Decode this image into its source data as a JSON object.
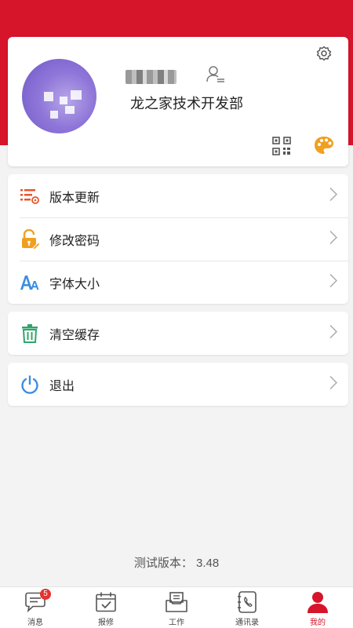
{
  "profile": {
    "department": "龙之家技术开发部",
    "avatar_icon": "blurred-avatar",
    "settings_icon": "gear-icon",
    "edit_profile_icon": "user-edit-icon",
    "qr_icon": "qr-code-icon",
    "theme_icon": "palette-icon"
  },
  "menu": {
    "group1": [
      {
        "label": "版本更新",
        "icon": "list-settings-icon"
      },
      {
        "label": "修改密码",
        "icon": "lock-edit-icon"
      },
      {
        "label": "字体大小",
        "icon": "font-size-icon"
      }
    ],
    "group2": [
      {
        "label": "清空缓存",
        "icon": "trash-icon"
      }
    ],
    "group3": [
      {
        "label": "退出",
        "icon": "power-icon"
      }
    ]
  },
  "version_text": "测试版本： 3.48",
  "tabbar": {
    "tabs": [
      {
        "label": "消息",
        "icon": "message-icon",
        "badge": "5"
      },
      {
        "label": "报修",
        "icon": "calendar-check-icon"
      },
      {
        "label": "工作",
        "icon": "inbox-icon"
      },
      {
        "label": "通讯录",
        "icon": "contacts-book-icon"
      },
      {
        "label": "我的",
        "icon": "user-icon",
        "active": true
      }
    ]
  },
  "colors": {
    "brand_red": "#d6142a",
    "orange_icon": "#f0a020",
    "blue_icon": "#3b8de0",
    "green_icon": "#2fa56a"
  }
}
